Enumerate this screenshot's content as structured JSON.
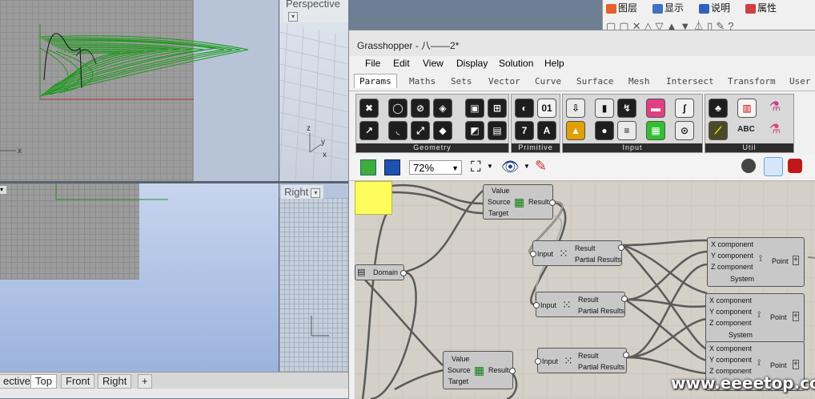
{
  "rhino": {
    "viewports": {
      "perspective_label": "Perspective",
      "right_label": "Right",
      "axis_x": "x",
      "axis_y": "y",
      "axis_z": "z"
    },
    "viewport_tabs": [
      "ective",
      "Top",
      "Front",
      "Right"
    ],
    "add_tab": "+",
    "layer_panel": {
      "tabs": [
        "图层",
        "显示",
        "说明",
        "属性"
      ]
    }
  },
  "grasshopper": {
    "title": "Grasshopper - 八——2*",
    "menu": [
      "File",
      "Edit",
      "View",
      "Display",
      "Solution",
      "Help"
    ],
    "tabs": [
      "Params",
      "Maths",
      "Sets",
      "Vector",
      "Curve",
      "Surface",
      "Mesh",
      "Intersect",
      "Transform",
      "User"
    ],
    "active_tab": "Params",
    "ribbon_groups": [
      "Geometry",
      "Primitive",
      "Input",
      "Util"
    ],
    "zoom": "72%",
    "components": {
      "domain": "Domain",
      "graph_mapper_1": {
        "inputs": [
          "Value",
          "Source",
          "Target"
        ],
        "output": "Result"
      },
      "graph_mapper_2": {
        "inputs": [
          "Value",
          "Source",
          "Target"
        ],
        "output": "Result"
      },
      "expr_1": {
        "input": "Input",
        "outputs": [
          "Result",
          "Partial Results"
        ]
      },
      "expr_2": {
        "input": "Input",
        "outputs": [
          "Result",
          "Partial Results"
        ]
      },
      "expr_3": {
        "input": "Input",
        "outputs": [
          "Result",
          "Partial Results"
        ]
      },
      "point_1": {
        "inputs": [
          "X component",
          "Y component",
          "Z component",
          "System"
        ],
        "output": "Point"
      },
      "point_2": {
        "inputs": [
          "X component",
          "Y component",
          "Z component",
          "System"
        ],
        "output": "Point"
      },
      "point_3": {
        "inputs": [
          "X component",
          "Y component",
          "Z component"
        ],
        "output": "Point"
      }
    }
  },
  "watermark": "www.eeeetop.com",
  "colors": {
    "curve_green": "#1a9a1a",
    "panel_yellow": "#fdfd5e",
    "canvas_bg": "#d4d0c8",
    "ribbon_label_bg": "#2c2c2c"
  }
}
